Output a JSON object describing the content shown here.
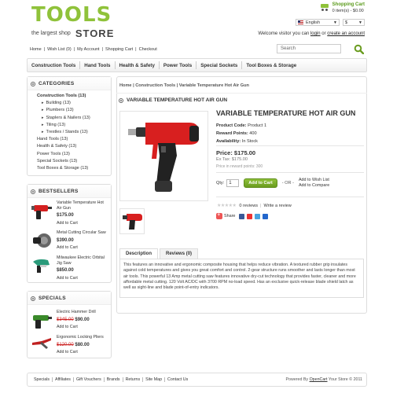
{
  "header": {
    "logo_main": "TOOLS",
    "logo_tagline": "the largest shop",
    "logo_store": "STORE",
    "cart_title": "Shopping Cart",
    "cart_summary": "0 item(s) - $0.00",
    "language": "English",
    "currency": "$",
    "welcome_prefix": "Welcome visitor you can",
    "login": "login",
    "welcome_or": "or",
    "create_account": "create an account"
  },
  "toplinks": [
    "Home",
    "|",
    "Wish List (0)",
    "|",
    "My Account",
    "|",
    "Shopping Cart",
    "|",
    "Checkout"
  ],
  "search": {
    "value": "Search"
  },
  "nav": [
    "Construction Tools",
    "Hand Tools",
    "Health & Safety",
    "Power Tools",
    "Special Sockets",
    "Tool Boxes & Storage"
  ],
  "categories": {
    "title": "CATEGORIES",
    "items": [
      {
        "label": "Construction Tools (13)",
        "type": "active"
      },
      {
        "label": "Building (13)",
        "type": "sub"
      },
      {
        "label": "Plumbers (13)",
        "type": "sub"
      },
      {
        "label": "Staplers & Nailers (13)",
        "type": "sub"
      },
      {
        "label": "Tiling (13)",
        "type": "sub"
      },
      {
        "label": "Trestles / Stands (13)",
        "type": "sub"
      },
      {
        "label": "Hand Tools (13)",
        "type": "top"
      },
      {
        "label": "Health & Safety (13)",
        "type": "top"
      },
      {
        "label": "Power Tools (13)",
        "type": "top"
      },
      {
        "label": "Special Sockets (13)",
        "type": "top"
      },
      {
        "label": "Tool Boxes & Storage (13)",
        "type": "top"
      }
    ]
  },
  "bestsellers": {
    "title": "BESTSELLERS",
    "items": [
      {
        "name": "Variable Temperature Hot Air Gun",
        "price": "$175.00",
        "add": "Add to Cart"
      },
      {
        "name": "Metal Cutting Circular Saw",
        "price": "$390.00",
        "add": "Add to Cart"
      },
      {
        "name": "Milwaukee Electric Orbital Jig Saw",
        "price": "$850.00",
        "add": "Add to Cart"
      }
    ]
  },
  "specials": {
    "title": "SPECIALS",
    "items": [
      {
        "name": "Electric Hammer Drill",
        "old_price": "$345.00",
        "price": "$90.00",
        "add": "Add to Cart"
      },
      {
        "name": "Ergonomic Locking Pliers",
        "old_price": "$120.00",
        "price": "$80.00",
        "add": "Add to Cart"
      }
    ]
  },
  "product": {
    "breadcrumb": "Home | Construction Tools | Variable Temperature Hot Air Gun",
    "heading": "VARIABLE TEMPERATURE HOT AIR GUN",
    "title": "VARIABLE TEMPERATURE HOT AIR GUN",
    "code_label": "Product Code:",
    "code_value": "Product 1",
    "points_label": "Reward Points:",
    "points_value": "400",
    "avail_label": "Availability:",
    "avail_value": "In Stock",
    "price": "Price: $175.00",
    "ex_tax": "Ex Tax: $175.00",
    "price_points": "Price in reward points: 300",
    "qty_label": "Qty:",
    "qty_value": "1",
    "add_to_cart": "Add to Cart",
    "or": "- OR -",
    "wish": "Add to Wish List",
    "compare": "Add to Compare",
    "reviews_count": "0 reviews",
    "write_review": "Write a review",
    "share": "Share",
    "tab_description": "Description",
    "tab_reviews": "Reviews (0)",
    "description": "This features an innovative and ergonomic composite housing that helps reduce vibration. A textured rubber grip insulates against cold temperatures and gives you great comfort and control. 2-gear structure runs smoother and lasts longer than most air tools. This powerful 13 Amp metal cutting saw features innovative dry-cut technology that provides faster, cleaner and more affordable metal cutting. 120 Volt AC/DC with 3700 RPM no-load speed. Has an exclusive quick-release blade shield latch as well as sight-line and blade point-of-entry indicators."
  },
  "footer": {
    "links": [
      "Specials",
      "Affiliates",
      "Gift Vouchers",
      "Brands",
      "Returns",
      "Site Map",
      "Contact Us"
    ],
    "powered_prefix": "Powered By",
    "powered_link": "OpenCart",
    "powered_suffix": "Your Store © 2011"
  },
  "colors": {
    "accent": "#8fc23a",
    "price_old": "#cc2222"
  }
}
